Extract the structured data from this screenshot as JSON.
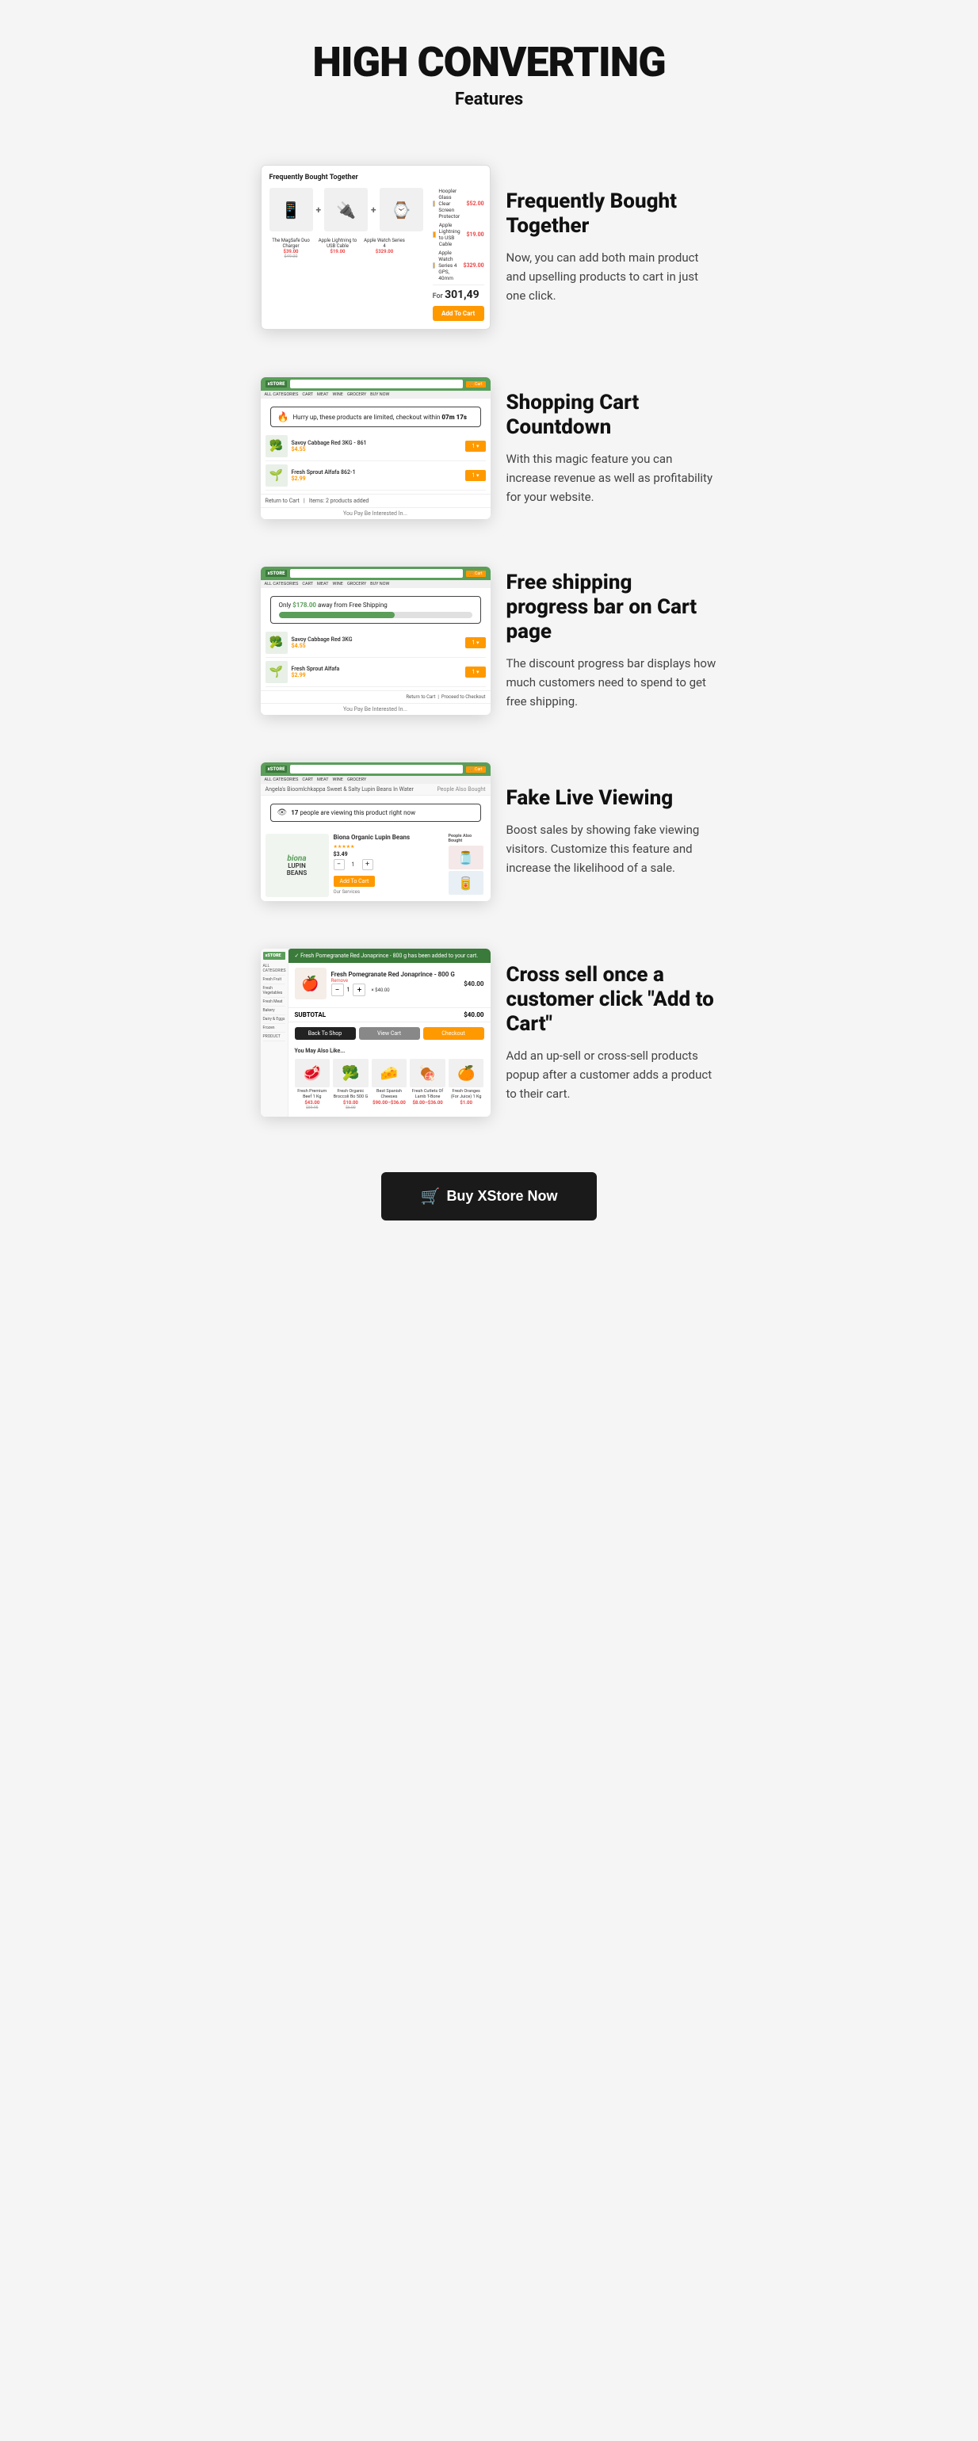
{
  "hero": {
    "title": "HIGH CONVERTING",
    "subtitle": "Features"
  },
  "features": [
    {
      "id": "fbt",
      "heading": "Frequently Bought Together",
      "description": "Now, you can add both main product and upselling products to cart in just one click.",
      "position": "right"
    },
    {
      "id": "countdown",
      "heading": "Shopping Cart Countdown",
      "description": "With this magic feature you can increase revenue as well as profitability for your website.",
      "position": "left",
      "countdown_text": "Hurry up, these products are limited, checkout within",
      "countdown_time": "07m 17s"
    },
    {
      "id": "freeshipping",
      "heading": "Free shipping progress bar on Cart page",
      "description": "The discount progress bar displays how much customers need to spend to get free shipping.",
      "position": "right",
      "shipping_text": "Only $178.00 away from Free Shipping"
    },
    {
      "id": "liveviewing",
      "heading": "Fake Live Viewing",
      "description": "Boost sales by showing fake viewing visitors. Customize this feature and increase the likelihood of a sale.",
      "position": "left",
      "viewing_text": "17 people are viewing this product right now"
    },
    {
      "id": "crosssell",
      "heading": "Cross sell once a customer click \"Add to Cart\"",
      "description": "Add an up-sell or cross-sell products popup after a customer adds a product to their cart.",
      "position": "right",
      "toast_text": "Fresh Pomegranate Red Jonaprince - 800 g has been added to your cart.",
      "product_name": "Fresh Pomegranate Red Jonaprince - 800 G",
      "remove_text": "Remove",
      "subtotal_label": "SUBTOTAL",
      "subtotal_value": "$40.00",
      "btn_back": "Back To Shop",
      "btn_view": "View Cart",
      "btn_checkout": "Checkout",
      "also_like": "You May Also Like...",
      "grid_items": [
        {
          "name": "Fresh Premium Beef 1 Kg",
          "price": "$43.00",
          "old_price": "$59.95",
          "emoji": "🥩"
        },
        {
          "name": "Fresh Organic Broccoli Bo 500 G",
          "price": "$10.00",
          "old_price": "$6.00",
          "emoji": "🥦"
        },
        {
          "name": "Best Spanish Cheeses",
          "price": "$90.00–$36.00",
          "old_price": "",
          "emoji": "🧀"
        },
        {
          "name": "Fresh Cutlets Of Lamb T-Bone",
          "price": "$8.00–$36.00",
          "old_price": "",
          "emoji": "🍖"
        },
        {
          "name": "Fresh Oranges (For Juice) 1 Kg",
          "price": "$1.00",
          "old_price": "",
          "emoji": "🍊"
        }
      ]
    }
  ],
  "cta": {
    "label": "Buy XStore Now",
    "cart_icon": "🛒"
  },
  "mock": {
    "store_logo": "xSTORE",
    "fbt_title": "Frequently Bought Together",
    "fbt_total": "301,49",
    "fbt_btn": "Add To Cart",
    "fbt_items": [
      {
        "emoji": "📱",
        "name": "The MagSafe Duo Charger",
        "price": "$39.00"
      },
      {
        "emoji": "🔌",
        "name": "Apple Lightning to USB Cable",
        "price": "$19.00"
      },
      {
        "emoji": "⌚",
        "name": "Apple Watch Series 4 GPS, 40mm",
        "price": "$329.00"
      }
    ],
    "countdown_banner": "Hurry up, these products are limited, checkout within 07m 17s",
    "shipping_banner": "Only $178.00 away from Free Shipping",
    "viewing_banner": "17 people are viewing this product right now",
    "product_biona": "biona",
    "product_beans": "Lupin Beans"
  }
}
